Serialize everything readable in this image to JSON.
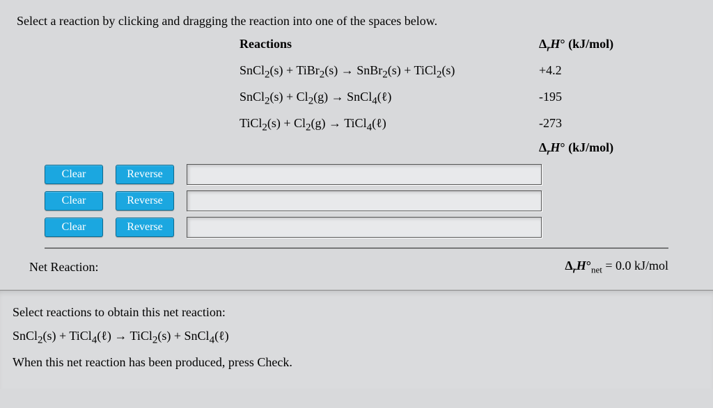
{
  "instruction": "Select a reaction by clicking and dragging the reaction into one of the spaces below.",
  "headers": {
    "reactions": "Reactions",
    "dh": "Δ",
    "dh_sub": "r",
    "dh_h": "H",
    "dh_deg": "°",
    "dh_unit": " (kJ/mol)"
  },
  "reactions": [
    {
      "eq_html": "SnCl<sub>2</sub>(s) + TiBr<sub>2</sub>(s) → SnBr<sub>2</sub>(s) + TiCl<sub>2</sub>(s)",
      "value": "+4.2"
    },
    {
      "eq_html": "SnCl<sub>2</sub>(s) + Cl<sub>2</sub>(g) → SnCl<sub>4</sub>(ℓ)",
      "value": "-195"
    },
    {
      "eq_html": "TiCl<sub>2</sub>(s) + Cl<sub>2</sub>(g) → TiCl<sub>4</sub>(ℓ)",
      "value": "-273"
    }
  ],
  "buttons": {
    "clear": "Clear",
    "reverse": "Reverse"
  },
  "net": {
    "label": "Net Reaction:",
    "result_prefix": "Δ",
    "result_sub1": "r",
    "result_h": "H",
    "result_deg": "°",
    "result_sub2": "net",
    "result_eq": " = 0.0 kJ/mol"
  },
  "bottom": {
    "line1": "Select reactions to obtain this net reaction:",
    "eq_html": "SnCl<sub>2</sub>(s) + TiCl<sub>4</sub>(ℓ) → TiCl<sub>2</sub>(s) + SnCl<sub>4</sub>(ℓ)",
    "line3": "When this net reaction has been produced, press Check."
  }
}
